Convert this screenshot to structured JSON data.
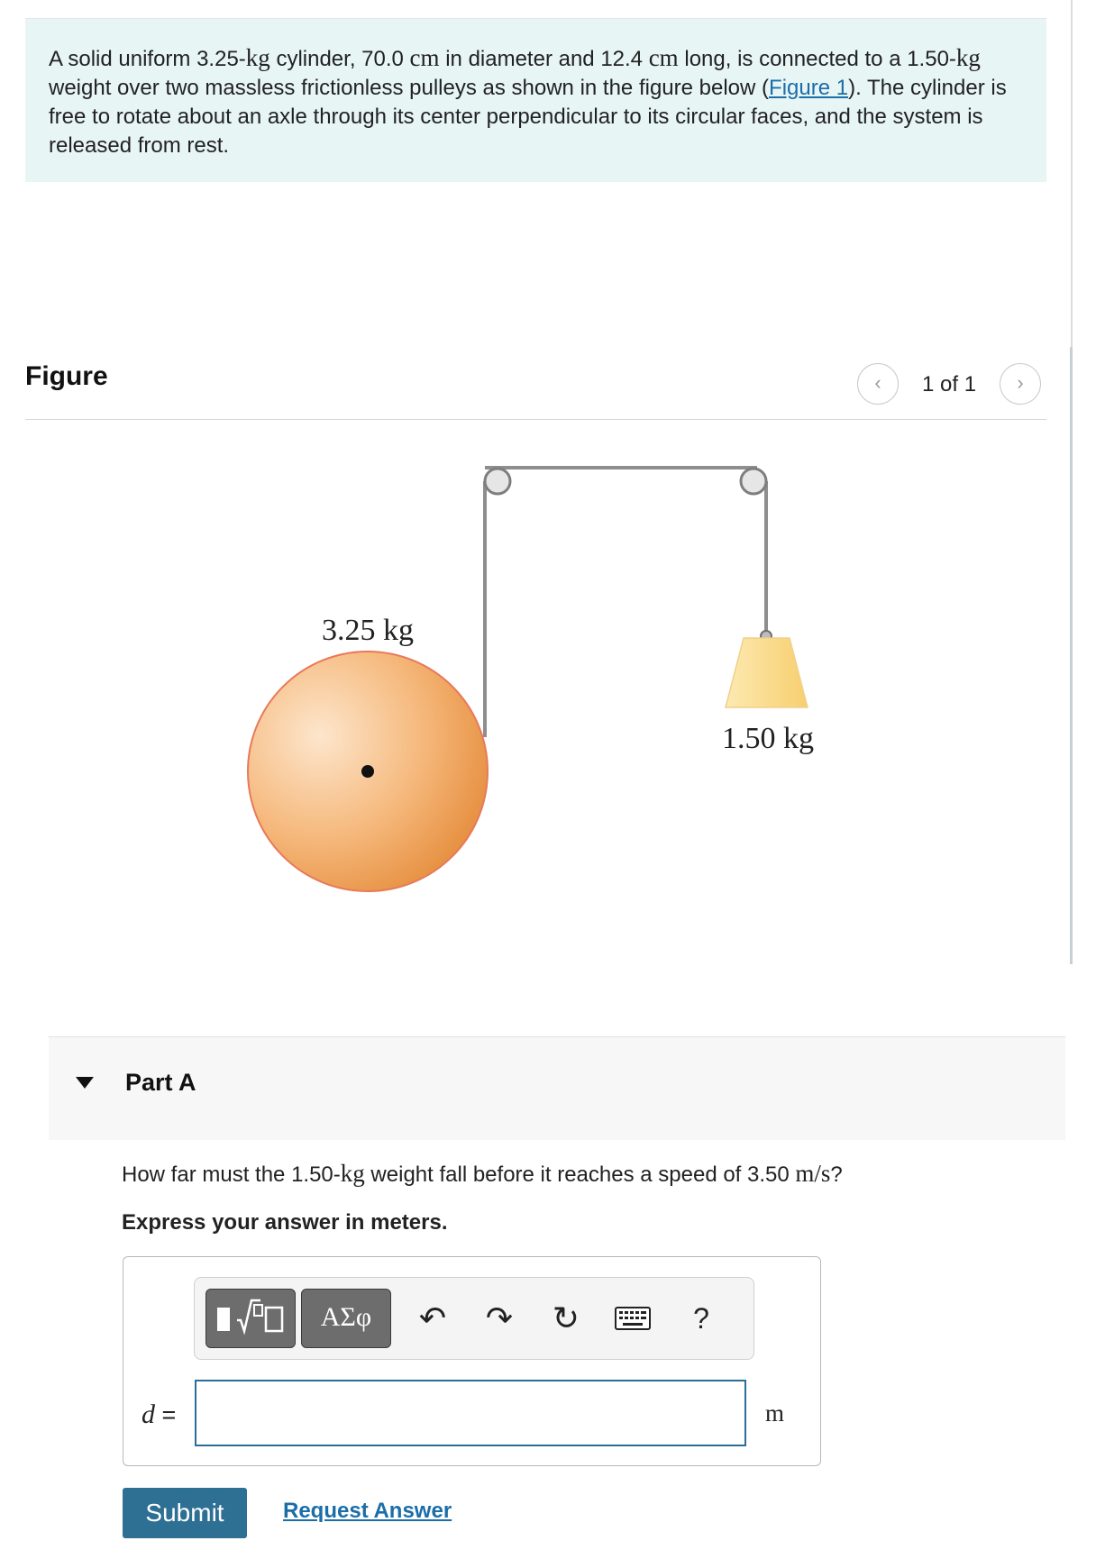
{
  "problem": {
    "text_1": "A solid uniform 3.25-",
    "unit_kg_1": "kg",
    "text_2": " cylinder, 70.0 ",
    "unit_cm_1": "cm",
    "text_3": " in diameter and 12.4 ",
    "unit_cm_2": "cm",
    "text_4": " long, is connected to a 1.50-",
    "unit_kg_2": "kg",
    "text_5": " weight over two massless frictionless pulleys as shown in the figure below (",
    "figure_link": "Figure 1",
    "text_6": "). The cylinder is free to rotate about an axle through its center perpendicular to its circular faces, and the system is released from rest."
  },
  "figure": {
    "title": "Figure",
    "pager": {
      "prev_icon": "chevron-left-icon",
      "next_icon": "chevron-right-icon",
      "count": "1 of 1"
    },
    "cylinder_label": "3.25 kg",
    "weight_label": "1.50 kg",
    "colors": {
      "cylinder_fill": "#f3b478",
      "cylinder_stroke": "#e8795a",
      "weight_fill": "#fce3a4",
      "rope": "#8e8e8e"
    }
  },
  "part": {
    "title": "Part A",
    "question_1": "How far must the 1.50-",
    "question_unit_kg": "kg",
    "question_2": " weight fall before it reaches a speed of 3.50 ",
    "question_unit_speed": "m/s",
    "question_3": "?",
    "instruction": "Express your answer in meters."
  },
  "answer": {
    "toolbar": {
      "templates_icon": "templates-icon",
      "greek_label": "ΑΣφ",
      "undo_icon": "undo-icon",
      "redo_icon": "redo-icon",
      "reset_icon": "reset-icon",
      "keyboard_icon": "keyboard-icon",
      "help_label": "?"
    },
    "variable": "d",
    "equals": " =",
    "value": "",
    "unit": "m"
  },
  "actions": {
    "submit_label": "Submit",
    "request_label": "Request Answer"
  }
}
